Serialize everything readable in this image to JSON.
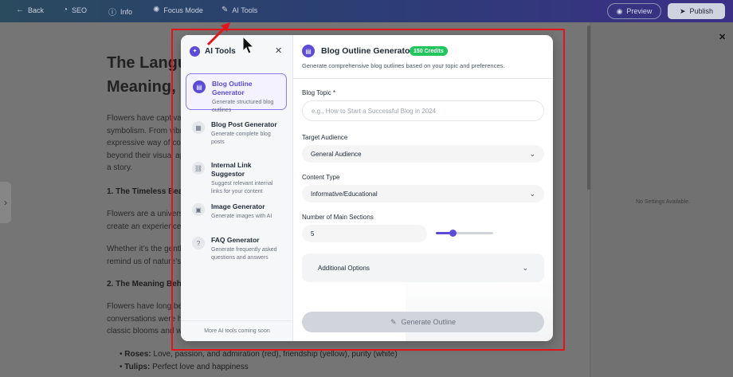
{
  "topbar": {
    "back": "Back",
    "seo": "SEO",
    "info": "Info",
    "focus": "Focus Mode",
    "ai_tools": "AI Tools",
    "preview": "Preview",
    "publish": "Publish"
  },
  "article": {
    "title_line1": "The Langu",
    "title_line2": "Meaning,",
    "p1": [
      "Flowers have captiva",
      "symbolism. From vibr",
      "expressive way of com",
      "beyond their visual ap",
      "a story."
    ],
    "h1": "1. The Timeless Beaut",
    "p2": [
      "Flowers are a univers",
      "create an experience"
    ],
    "p3": [
      "Whether it’s the gentl",
      "remind us of nature’s"
    ],
    "h2": "2. The Meaning Behin",
    "p4": [
      "Flowers have long bee",
      "conversations were h",
      "classic blooms and w"
    ],
    "bullets": [
      {
        "term": "Roses:",
        "text": " Love, passion, and admiration (red), friendship (yellow), purity (white)"
      },
      {
        "term": "Tulips:",
        "text": " Perfect love and happiness"
      }
    ]
  },
  "right_panel": {
    "no_settings": "No Settings Available."
  },
  "modal": {
    "title": "AI Tools",
    "tools": [
      {
        "name": "Blog Outline Generator",
        "desc_lines": [
          "Generate structured blog",
          "outlines"
        ]
      },
      {
        "name": "Blog Post Generator",
        "desc_lines": [
          "Generate complete blog",
          "posts"
        ]
      },
      {
        "name": "Internal Link Suggestor",
        "desc_lines": [
          "Suggest relevant internal",
          "links for your content"
        ]
      },
      {
        "name": "Image Generator",
        "desc_lines": [
          "Generate images with AI"
        ]
      },
      {
        "name": "FAQ Generator",
        "desc_lines": [
          "Generate frequently asked",
          "questions and answers"
        ]
      }
    ],
    "footer": "More AI tools coming soon",
    "panel": {
      "title": "Blog Outline Generator",
      "credits": "150 Credits",
      "subtitle": "Generate comprehensive blog outlines based on your topic and preferences.",
      "topic_label": "Blog Topic *",
      "topic_placeholder": "e.g., How to Start a Successful Blog in 2024",
      "audience_label": "Target Audience",
      "audience_value": "General Audience",
      "content_label": "Content Type",
      "content_value": "Informative/Educational",
      "sections_label": "Number of Main Sections",
      "sections_value": "5",
      "sections_slider_fraction": 0.3,
      "additional": "Additional Options",
      "generate": "Generate Outline"
    }
  },
  "colors": {
    "accent": "#5b4bd6",
    "credits": "#22c55e",
    "annotation": "#e0161b"
  }
}
